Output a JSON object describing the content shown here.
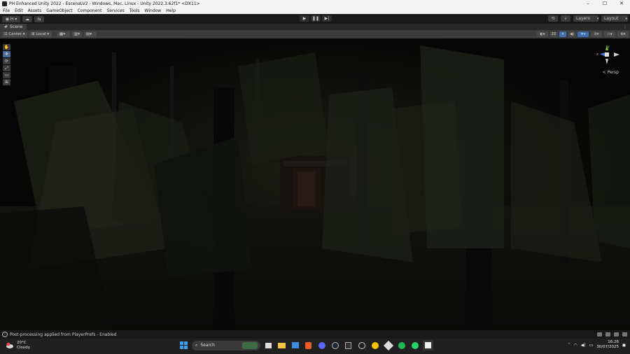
{
  "window": {
    "title": "PH Enhanced Unity 2022 - EscenaLV2 - Windows, Mac, Linux - Unity 2022.3.62f1* <DX11>",
    "controls": [
      "–",
      "☐",
      "✕"
    ]
  },
  "menu": [
    "File",
    "Edit",
    "Assets",
    "GameObject",
    "Component",
    "Services",
    "Tools",
    "Window",
    "Help"
  ],
  "toolbar": {
    "account_label": "H",
    "layers_label": "Layers",
    "layout_label": "Layout"
  },
  "scene": {
    "tab_label": "Scene",
    "pivot_label": "Center",
    "space_label": "Local",
    "camera_label": "< Persp",
    "gizmo_axes": {
      "y": "y",
      "z": "z"
    }
  },
  "status": {
    "message": "Post-processing applied from PlayerPrefs - Enabled"
  },
  "taskbar": {
    "weather_temp": "20°C",
    "weather_desc": "Cloudy",
    "search_placeholder": "Search",
    "time": "16:26",
    "date": "30/07/2025"
  },
  "colors": {
    "accent": "#3d6fb0",
    "windows_blue": "#0078d4"
  }
}
